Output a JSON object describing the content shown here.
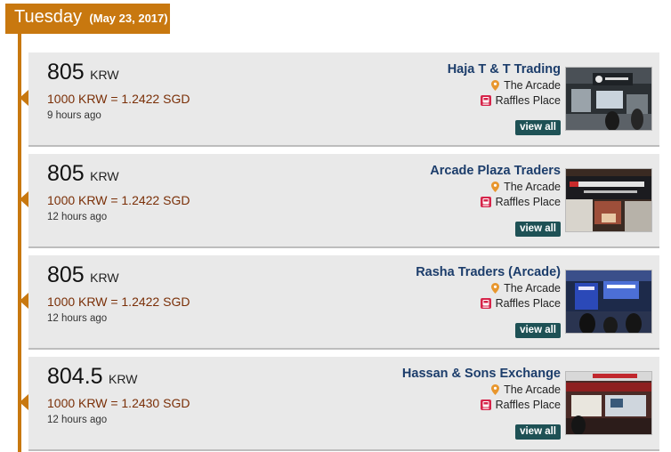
{
  "day": {
    "name": "Tuesday",
    "date": "(May 23, 2017)"
  },
  "colors": {
    "accent": "#c8780f",
    "conversion_text": "#7a2f07",
    "merchant_name": "#1c3d6b",
    "view_all_bg": "#1e5155"
  },
  "icons": {
    "location": "map-pin-icon",
    "mrt": "train-station-icon"
  },
  "rates": [
    {
      "value": "805",
      "currency": "KRW",
      "conversion": "1000 KRW = 1.2422 SGD",
      "age": "9 hours ago",
      "merchant": "Haja T & T Trading",
      "area": "The Arcade",
      "mrt": "Raffles Place",
      "action": "view all"
    },
    {
      "value": "805",
      "currency": "KRW",
      "conversion": "1000 KRW = 1.2422 SGD",
      "age": "12 hours ago",
      "merchant": "Arcade Plaza Traders",
      "area": "The Arcade",
      "mrt": "Raffles Place",
      "action": "view all"
    },
    {
      "value": "805",
      "currency": "KRW",
      "conversion": "1000 KRW = 1.2422 SGD",
      "age": "12 hours ago",
      "merchant": "Rasha Traders (Arcade)",
      "area": "The Arcade",
      "mrt": "Raffles Place",
      "action": "view all"
    },
    {
      "value": "804.5",
      "currency": "KRW",
      "conversion": "1000 KRW = 1.2430 SGD",
      "age": "12 hours ago",
      "merchant": "Hassan & Sons Exchange",
      "area": "The Arcade",
      "mrt": "Raffles Place",
      "action": "view all"
    }
  ]
}
